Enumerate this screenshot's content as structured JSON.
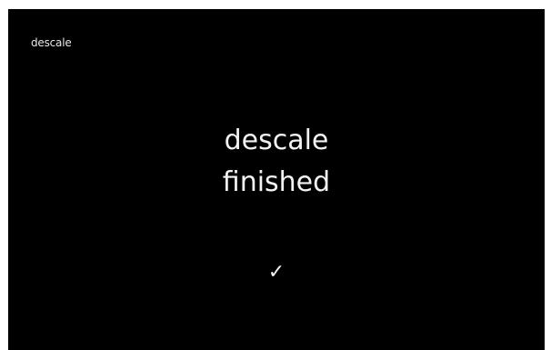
{
  "screen": {
    "title": "descale",
    "message_line1": "descale",
    "message_line2": "finished",
    "status_icon": "checkmark-icon"
  },
  "colors": {
    "background": "#000000",
    "text": "#f2f2f2"
  }
}
